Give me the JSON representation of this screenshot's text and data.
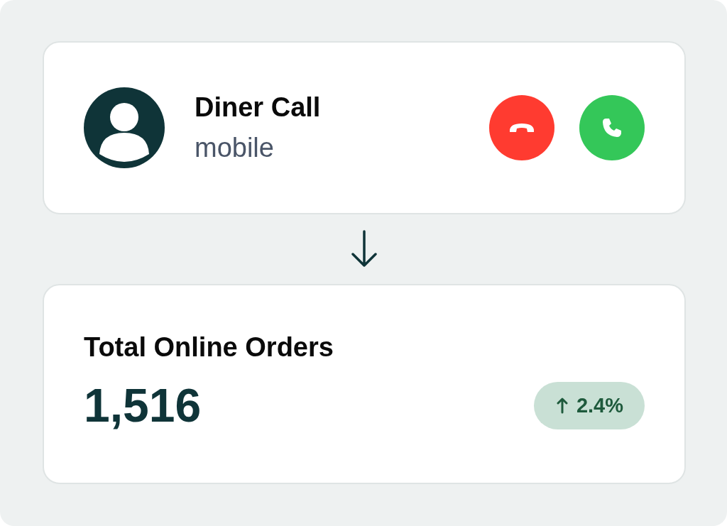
{
  "call_card": {
    "title": "Diner Call",
    "subtitle": "mobile",
    "actions": [
      {
        "kind": "decline"
      },
      {
        "kind": "accept"
      }
    ]
  },
  "stat_card": {
    "title": "Total Online Orders",
    "value": "1,516",
    "change": {
      "kind": "up",
      "text": "2.4%"
    }
  }
}
